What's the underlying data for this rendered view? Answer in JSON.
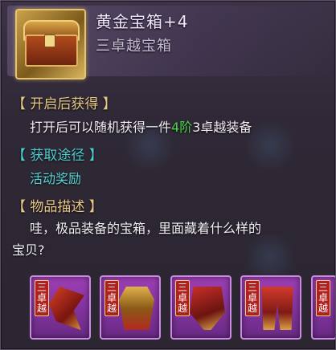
{
  "item": {
    "name": "黄金宝箱+4",
    "type": "三卓越宝箱",
    "icon": "golden-chest-icon"
  },
  "sections": {
    "open_gain": {
      "header": "【 开启后获得 】",
      "text_before": "打开后可以随机获得一件",
      "text_highlight": "4阶",
      "text_after": "3卓越装备",
      "highlight_color": "#4ad84a"
    },
    "obtain_method": {
      "header": "【 获取途径 】",
      "text": "活动奖励"
    },
    "description": {
      "header": "【 物品描述 】",
      "line1": "哇，极品装备的宝箱，里面藏着什么样的",
      "line2": "宝贝?"
    }
  },
  "rewards": [
    {
      "tag": "三卓越",
      "icon": "claw-weapon-icon"
    },
    {
      "tag": "三卓越",
      "icon": "golden-armor-icon"
    },
    {
      "tag": "三卓越",
      "icon": "red-gauntlet-icon"
    },
    {
      "tag": "三卓越",
      "icon": "red-leggings-icon"
    },
    {
      "tag": "三卓越",
      "icon": "equipment-icon"
    }
  ],
  "colors": {
    "header_gold": "#e9c886",
    "teal": "#4ecdd0",
    "reward_frame": "#9d3fb6"
  }
}
